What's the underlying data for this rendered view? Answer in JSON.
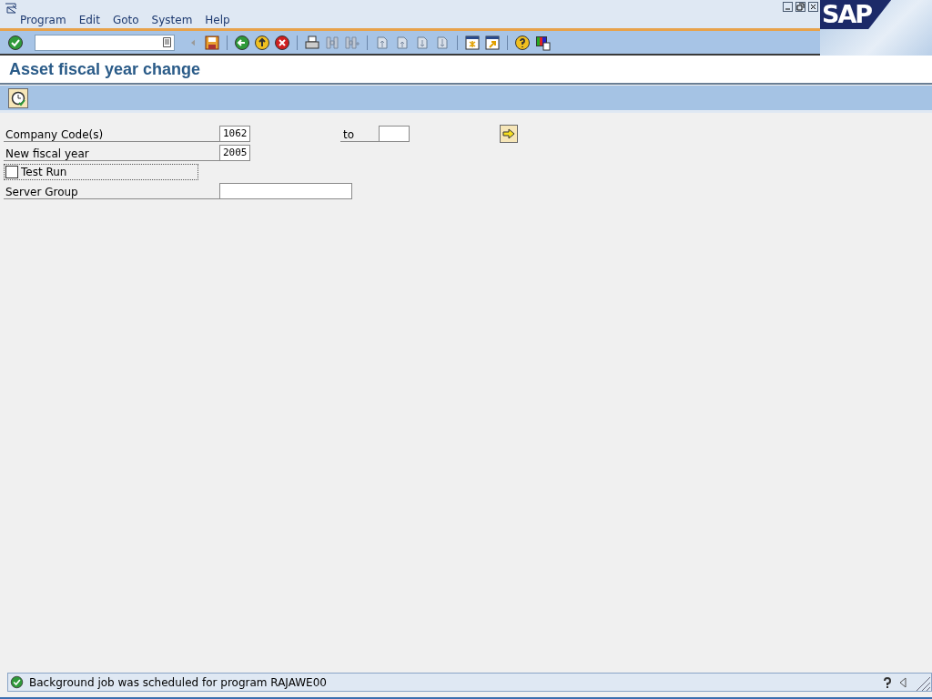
{
  "menu": [
    "Program",
    "Edit",
    "Goto",
    "System",
    "Help"
  ],
  "logo": "SAP",
  "title": "Asset fiscal year change",
  "fields": [
    {
      "kind": "range",
      "label": "Company Code(s)",
      "value": "1062",
      "to_label": "to"
    },
    {
      "kind": "input",
      "label": "New fiscal year",
      "value": "2005"
    },
    {
      "kind": "checkbox",
      "label": "Test Run",
      "checked": false
    },
    {
      "kind": "wide",
      "label": "Server Group"
    }
  ],
  "status": {
    "message": "Background job was scheduled for program RAJAWE00"
  }
}
